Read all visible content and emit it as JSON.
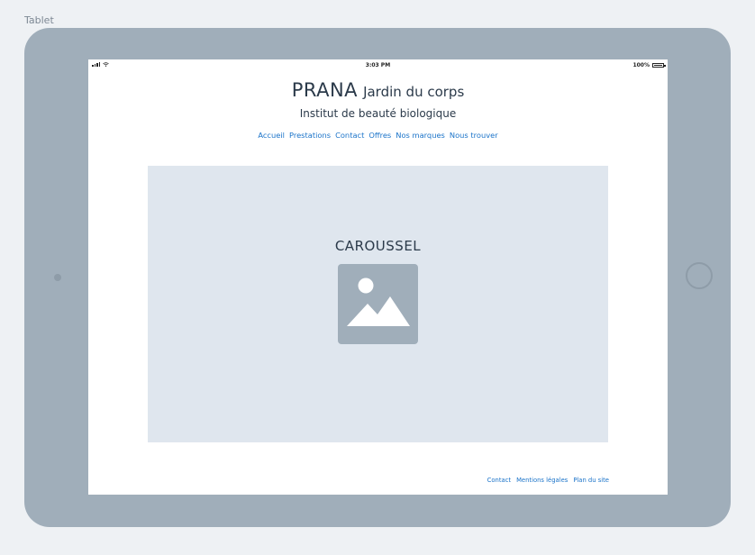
{
  "frame": {
    "label": "Tablet"
  },
  "status_bar": {
    "time": "3:03 PM",
    "battery": "100%"
  },
  "header": {
    "brand_name": "PRANA",
    "brand_sub": "Jardin du corps",
    "tagline": "Institut de beauté biologique"
  },
  "nav": {
    "items": [
      "Accueil",
      "Prestations",
      "Contact",
      "Offres",
      "Nos marques",
      "Nous trouver"
    ]
  },
  "carousel": {
    "label": "CAROUSSEL",
    "image_icon": "image-placeholder-icon"
  },
  "footer": {
    "links": [
      "Contact",
      "Mentions légales",
      "Plan du site"
    ]
  },
  "colors": {
    "link": "#1a73c9",
    "device_frame": "#a0aeba",
    "carousel_bg": "#dfe6ee",
    "text": "#2b3a4a"
  }
}
